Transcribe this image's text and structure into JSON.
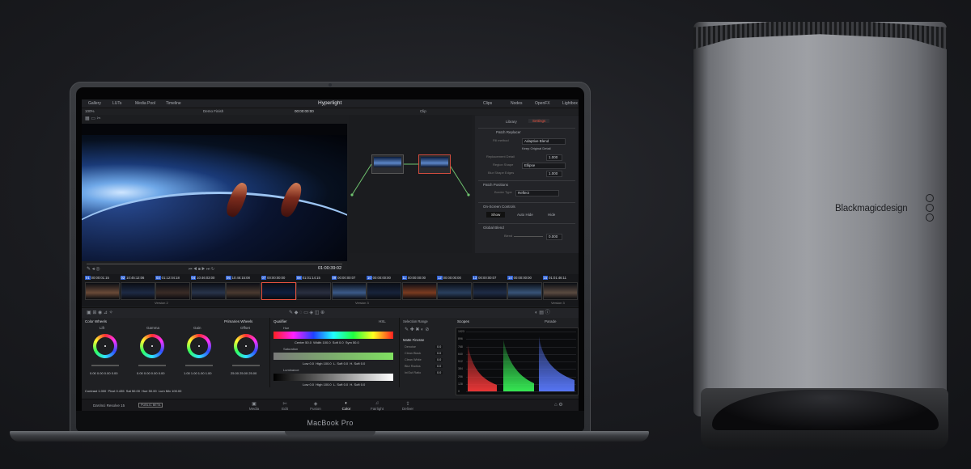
{
  "laptop": {
    "brand": "MacBook Pro"
  },
  "egpu": {
    "brand": "Blackmagicdesign"
  },
  "resolve": {
    "top_tabs": [
      "Gallery",
      "LUTs",
      "Media Pool",
      "Timeline"
    ],
    "project_title": "Hyperlight",
    "right_tabs": [
      "Clips",
      "Nodes",
      "OpenFX",
      "Lightbox"
    ],
    "zoom": "100%",
    "timeline_name": "Demo Finish",
    "viewer_timecode_top": "00:00:00:00",
    "clip_label": "Clip",
    "viewer_timecode": "01:00:39:02",
    "inspector": {
      "tabs": [
        "Library",
        "Settings"
      ],
      "effect": "Patch Replacer",
      "fill_method_label": "Fill method",
      "fill_method": "Adaptive Blend",
      "keep_original": "Keep Original Detail",
      "replacement_detail_label": "Replacement Detail",
      "replacement_detail": "1.000",
      "region_shape_label": "Region Shape",
      "region_shape": "Ellipse",
      "blur_shape_label": "Blur Shape Edges",
      "blur_shape": "1.000",
      "patch_positions": "Patch Positions",
      "border_type_label": "Border Type",
      "border_type": "Reflect",
      "on_screen": "On-Screen Controls",
      "osc_options": [
        "Show",
        "Auto Hide",
        "Hide"
      ],
      "global_blend": "Global Blend",
      "blend_label": "Blend",
      "blend": "0.000"
    },
    "clips": [
      {
        "n": "01",
        "tc": "00:00:01:15"
      },
      {
        "n": "02",
        "tc": "10:45:12:06"
      },
      {
        "n": "03",
        "tc": "01:12:04:18"
      },
      {
        "n": "04",
        "tc": "10:46:03:00"
      },
      {
        "n": "05",
        "tc": "10:46:15:08"
      },
      {
        "n": "07",
        "tc": "00:00:00:00"
      },
      {
        "n": "08",
        "tc": "01:01:14:15"
      },
      {
        "n": "09",
        "tc": "00:00:00:07"
      },
      {
        "n": "10",
        "tc": "00:00:00:00"
      },
      {
        "n": "11",
        "tc": "00:00:00:00"
      },
      {
        "n": "12",
        "tc": "00:00:00:00"
      },
      {
        "n": "13",
        "tc": "00:00:00:07"
      },
      {
        "n": "14",
        "tc": "00:00:00:00"
      },
      {
        "n": "15",
        "tc": "01:01:46:11"
      }
    ],
    "version_labels": [
      "Version 2",
      "Version 3",
      "Version 3"
    ],
    "color_wheels_label": "Color Wheels",
    "primaries_label": "Primaries Wheels",
    "wheels": [
      {
        "name": "Lift",
        "vals": "0.00  0.00  0.00  0.00"
      },
      {
        "name": "Gamma",
        "vals": "0.00  0.00  0.00  0.00"
      },
      {
        "name": "Gain",
        "vals": "1.00  1.00  1.00  1.00"
      },
      {
        "name": "Offset",
        "vals": "25.00  25.00  25.00"
      }
    ],
    "adjust_row": {
      "contrast_label": "Contrast",
      "contrast": "1.000",
      "pivot_label": "Pivot",
      "pivot": "0.435",
      "sat_label": "Sat",
      "sat": "50.00",
      "hue_label": "Hue",
      "hue": "50.00",
      "lummix_label": "Lum Mix",
      "lummix": "100.00"
    },
    "qualifier": {
      "title": "Qualifier",
      "mode": "HSL",
      "hue": "Hue",
      "center_label": "Center",
      "center": "50.0",
      "width_label": "Width",
      "width": "100.0",
      "soft_label": "Soft",
      "soft": "0.0",
      "sym_label": "Sym",
      "sym": "50.0",
      "saturation": "Saturation",
      "luminance": "Luminance",
      "low_label": "Low",
      "low": "0.0",
      "high_label": "High",
      "high": "100.0",
      "lsoft_label": "L. Soft",
      "lsoft": "0.0",
      "hsoft_label": "H. Soft",
      "hsoft": "0.0"
    },
    "selection_range": "Selection Range",
    "matte_finesse": {
      "title": "Matte Finesse",
      "rows": [
        {
          "l": "Denoise",
          "v": "0.0"
        },
        {
          "l": "Clean Black",
          "v": "0.0"
        },
        {
          "l": "Clean White",
          "v": "0.0"
        },
        {
          "l": "Blur Radius",
          "v": "0.0"
        },
        {
          "l": "In/Out Ratio",
          "v": "0.0"
        }
      ]
    },
    "scopes": {
      "title": "Scopes",
      "type": "Parade",
      "ticks": [
        "1023",
        "896",
        "768",
        "640",
        "512",
        "384",
        "256",
        "128",
        "0"
      ]
    },
    "app_name": "DaVinci Resolve 15",
    "badge": "PUBLIC BETA",
    "pages": [
      "Media",
      "Edit",
      "Fusion",
      "Color",
      "Fairlight",
      "Deliver"
    ],
    "active_page": "Color"
  }
}
